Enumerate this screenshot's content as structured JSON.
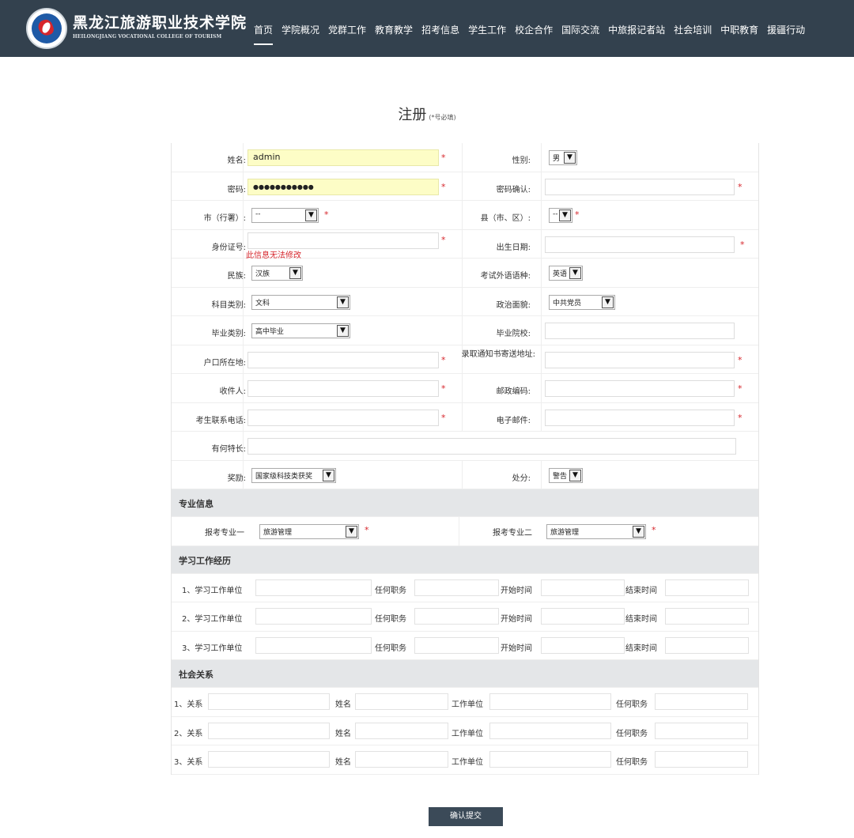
{
  "header": {
    "logo_cn": "黑龙江旅游职业技术学院",
    "logo_en": "HEILONGJIANG VOCATIONAL COLLEGE OF TOURISM",
    "nav": [
      "首页",
      "学院概况",
      "党群工作",
      "教育教学",
      "招考信息",
      "学生工作",
      "校企合作",
      "国际交流",
      "中旅报记者站",
      "社会培训",
      "中职教育",
      "援疆行动"
    ],
    "active_nav": "首页"
  },
  "title": "注册",
  "title_note": "(*号必填)",
  "labels": {
    "name": "姓名:",
    "gender": "性别:",
    "password": "密码:",
    "password_confirm": "密码确认:",
    "city": "市（行署）:",
    "county": "县（市、区）:",
    "id_number": "身份证号:",
    "birth": "出生日期:",
    "ethnic": "民族:",
    "foreign_lang": "考试外语语种:",
    "subject": "科目类别:",
    "political": "政治面貌:",
    "grad_type": "毕业类别:",
    "grad_school": "毕业院校:",
    "hukou": "户口所在地:",
    "mail_addr": "录取通知书寄送地址:",
    "receiver": "收件人:",
    "postcode": "邮政编码:",
    "phone": "考生联系电话:",
    "email": "电子邮件:",
    "specialty": "有何特长:",
    "award": "奖励:",
    "punish": "处分:"
  },
  "values": {
    "name": "admin",
    "password_mask": "●●●●●●●●●●●",
    "gender": "男",
    "city": "--",
    "county": "--",
    "ethnic": "汉族",
    "foreign_lang": "英语",
    "subject": "文科",
    "political": "中共党员",
    "grad_type": "高中毕业",
    "award": "国家级科技类获奖",
    "punish": "警告"
  },
  "id_note": "此信息无法修改",
  "star": "*",
  "major": {
    "section": "专业信息",
    "label1": "报考专业一",
    "value1": "旅游管理",
    "label2": "报考专业二",
    "value2": "旅游管理"
  },
  "work": {
    "section": "学习工作经历",
    "rows": [
      {
        "unit": "1、学习工作单位",
        "duty": "任何职务",
        "start": "开始时间",
        "end": "结束时间"
      },
      {
        "unit": "2、学习工作单位",
        "duty": "任何职务",
        "start": "开始时间",
        "end": "结束时间"
      },
      {
        "unit": "3、学习工作单位",
        "duty": "任何职务",
        "start": "开始时间",
        "end": "结束时间"
      }
    ]
  },
  "social": {
    "section": "社会关系",
    "rows": [
      {
        "rel": "1、关系",
        "name": "姓名",
        "unit": "工作单位",
        "duty": "任何职务"
      },
      {
        "rel": "2、关系",
        "name": "姓名",
        "unit": "工作单位",
        "duty": "任何职务"
      },
      {
        "rel": "3、关系",
        "name": "姓名",
        "unit": "工作单位",
        "duty": "任何职务"
      }
    ]
  },
  "submit_label": "确认提交"
}
